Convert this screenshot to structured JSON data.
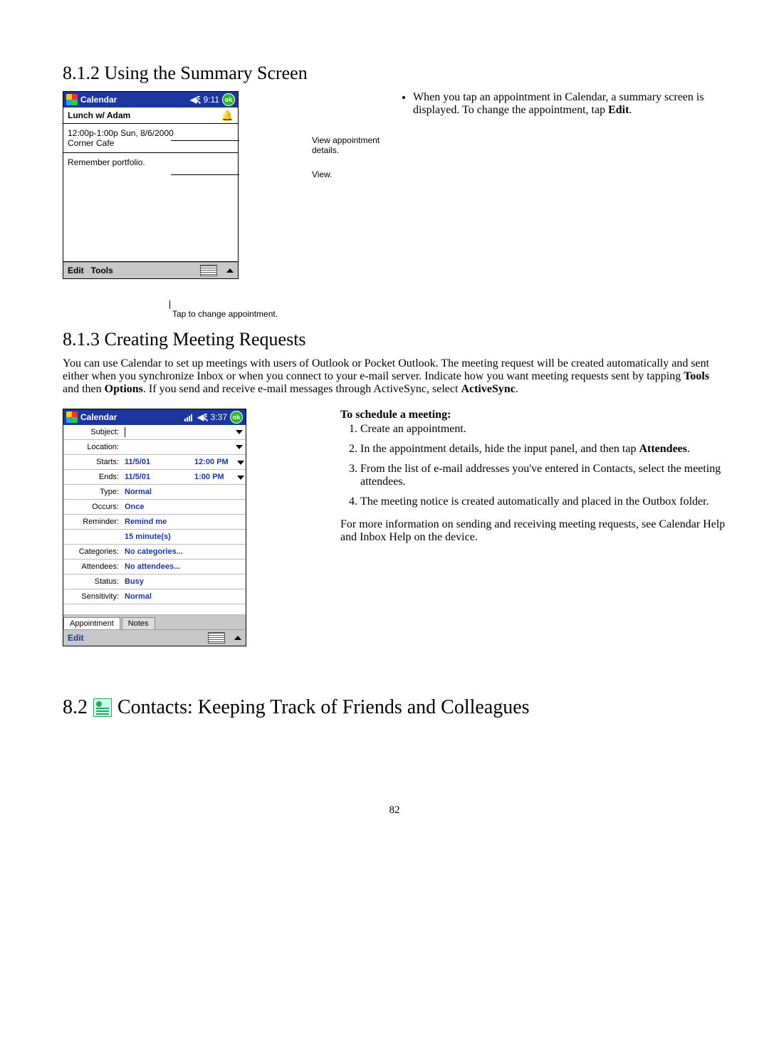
{
  "section812": {
    "heading": "8.1.2 Using the Summary Screen",
    "callout1": "View appointment details.",
    "callout2": "View.",
    "callout3": "Tap to change appointment.",
    "right_bullet": "When you tap an appointment in Calendar, a summary screen is displayed. To change the appointment, tap ",
    "right_bullet_bold": "Edit",
    "right_bullet_end": "."
  },
  "device1": {
    "title": "Calendar",
    "time": "9:11",
    "ok": "ok",
    "subject": "Lunch w/ Adam",
    "detail_line1": "12:00p-1:00p Sun, 8/6/2000",
    "detail_line2": "Corner Cafe",
    "note": "Remember portfolio.",
    "menu1": "Edit",
    "menu2": "Tools"
  },
  "section813": {
    "heading": "8.1.3 Creating Meeting Requests",
    "para_a": "You can use Calendar to set up meetings with users of Outlook or Pocket Outlook. The meeting request will be created automatically and sent either when you synchronize Inbox or when you connect to your e-mail server. Indicate how you want meeting requests sent by tapping ",
    "para_b": "Tools",
    "para_c": " and then ",
    "para_d": "Options",
    "para_e": ". If you send and receive e-mail messages through ActiveSync, select ",
    "para_f": "ActiveSync",
    "para_g": ".",
    "right_head": "To schedule a meeting:",
    "steps": [
      "Create an appointment.",
      "In the appointment details, hide the input panel, and then tap ",
      "From the list of e-mail addresses you've entered in Contacts, select the meeting attendees.",
      "The meeting notice is created automatically and placed in the Outbox folder."
    ],
    "step2_bold": "Attendees",
    "step2_end": ".",
    "footer": "For more information on sending and receiving meeting requests, see Calendar Help and Inbox Help on the device."
  },
  "device2": {
    "title": "Calendar",
    "time": "3:37",
    "ok": "ok",
    "rows": {
      "subject_lbl": "Subject:",
      "location_lbl": "Location:",
      "starts_lbl": "Starts:",
      "starts_date": "11/5/01",
      "starts_time": "12:00 PM",
      "ends_lbl": "Ends:",
      "ends_date": "11/5/01",
      "ends_time": "1:00 PM",
      "type_lbl": "Type:",
      "type_val": "Normal",
      "occurs_lbl": "Occurs:",
      "occurs_val": "Once",
      "reminder_lbl": "Reminder:",
      "reminder_val": "Remind me",
      "reminder2_val": "15   minute(s)",
      "categories_lbl": "Categories:",
      "categories_val": "No categories...",
      "attendees_lbl": "Attendees:",
      "attendees_val": "No attendees...",
      "status_lbl": "Status:",
      "status_val": "Busy",
      "sensitivity_lbl": "Sensitivity:",
      "sensitivity_val": "Normal"
    },
    "tab1": "Appointment",
    "tab2": "Notes",
    "menu1": "Edit"
  },
  "section82": {
    "heading": "8.2",
    "heading_rest": " Contacts: Keeping Track of Friends and Colleagues"
  },
  "page_number": "82"
}
